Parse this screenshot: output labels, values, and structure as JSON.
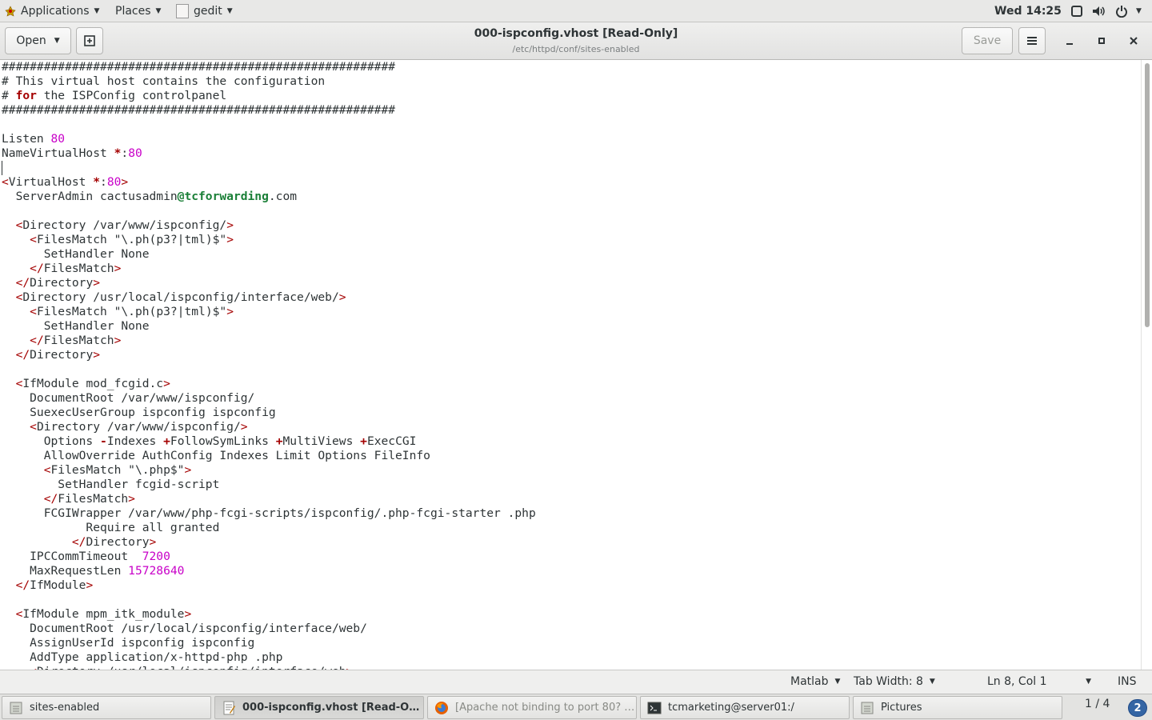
{
  "topbar": {
    "applications": "Applications",
    "places": "Places",
    "app_name": "gedit",
    "clock": "Wed 14:25"
  },
  "header": {
    "open_label": "Open",
    "title": "000-ispconfig.vhost [Read-Only]",
    "subtitle": "/etc/httpd/conf/sites-enabled",
    "save_label": "Save"
  },
  "editor": {
    "lines": [
      "########################################################",
      "# This virtual host contains the configuration",
      "# for the ISPConfig controlpanel",
      "########################################################",
      "",
      "Listen 80",
      "NameVirtualHost *:80",
      "",
      "<VirtualHost *:80>",
      "  ServerAdmin cactusadmin@tcforwarding.com",
      "",
      "  <Directory /var/www/ispconfig/>",
      "    <FilesMatch \"\\.ph(p3?|tml)$\">",
      "      SetHandler None",
      "    </FilesMatch>",
      "  </Directory>",
      "  <Directory /usr/local/ispconfig/interface/web/>",
      "    <FilesMatch \"\\.ph(p3?|tml)$\">",
      "      SetHandler None",
      "    </FilesMatch>",
      "  </Directory>",
      "",
      "  <IfModule mod_fcgid.c>",
      "    DocumentRoot /var/www/ispconfig/",
      "    SuexecUserGroup ispconfig ispconfig",
      "    <Directory /var/www/ispconfig/>",
      "      Options -Indexes +FollowSymLinks +MultiViews +ExecCGI",
      "      AllowOverride AuthConfig Indexes Limit Options FileInfo",
      "      <FilesMatch \"\\.php$\">",
      "        SetHandler fcgid-script",
      "      </FilesMatch>",
      "      FCGIWrapper /var/www/php-fcgi-scripts/ispconfig/.php-fcgi-starter .php",
      "            Require all granted",
      "          </Directory>",
      "    IPCCommTimeout  7200",
      "    MaxRequestLen 15728640",
      "  </IfModule>",
      "",
      "  <IfModule mpm_itk_module>",
      "    DocumentRoot /usr/local/ispconfig/interface/web/",
      "    AssignUserId ispconfig ispconfig",
      "    AddType application/x-httpd-php .php",
      "    <Directory /usr/local/ispconfig/interface/web>"
    ]
  },
  "statusbar": {
    "language": "Matlab",
    "tab_width": "Tab Width: 8",
    "position": "Ln 8, Col 1",
    "mode": "INS"
  },
  "taskbar": {
    "tasks": [
      {
        "label": "sites-enabled",
        "icon": "folder-icon"
      },
      {
        "label": "000-ispconfig.vhost [Read-Only]...",
        "icon": "gedit-icon"
      },
      {
        "label": "[Apache not binding to port 80? -...",
        "icon": "firefox-icon"
      },
      {
        "label": "tcmarketing@server01:/",
        "icon": "terminal-icon"
      },
      {
        "label": "Pictures",
        "icon": "folder-icon"
      }
    ],
    "pager": "1 / 4",
    "notifications": "2"
  }
}
